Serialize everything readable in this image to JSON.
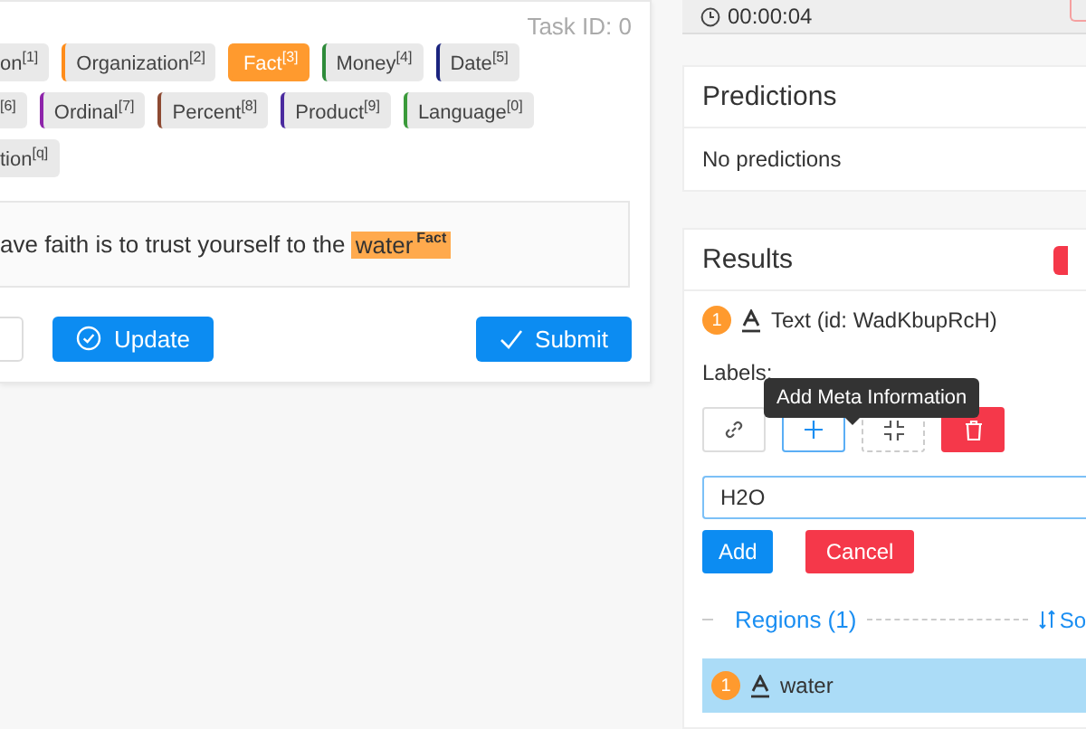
{
  "task": {
    "task_id": "Task ID: 0"
  },
  "label_rows": [
    [
      {
        "text": "on",
        "hotkey": "[1]",
        "selected": false
      },
      {
        "text": "Organization",
        "hotkey": "[2]",
        "color": "#ff8c1a",
        "selected": false
      },
      {
        "text": "Fact",
        "hotkey": "[3]",
        "color": "#ff9a2e",
        "selected": true
      },
      {
        "text": "Money",
        "hotkey": "[4]",
        "color": "#2e8b3a",
        "selected": false
      },
      {
        "text": "Date",
        "hotkey": "[5]",
        "color": "#1a237e",
        "selected": false
      }
    ],
    [
      {
        "text": "",
        "hotkey": "[6]",
        "selected": false
      },
      {
        "text": "Ordinal",
        "hotkey": "[7]",
        "color": "#8e24aa",
        "selected": false
      },
      {
        "text": "Percent",
        "hotkey": "[8]",
        "color": "#8d4a32",
        "selected": false
      },
      {
        "text": "Product",
        "hotkey": "[9]",
        "color": "#4a2a9e",
        "selected": false
      },
      {
        "text": "Language",
        "hotkey": "[0]",
        "color": "#3a9a3a",
        "selected": false
      }
    ],
    [
      {
        "text": "tion",
        "hotkey": "[q]",
        "selected": false
      }
    ]
  ],
  "sentence": {
    "before": "ave faith is to trust yourself to the ",
    "highlight": "water",
    "highlight_label": "Fact"
  },
  "buttons": {
    "update": "Update",
    "submit": "Submit"
  },
  "timer": "00:00:04",
  "predictions": {
    "title": "Predictions",
    "empty": "No predictions"
  },
  "results": {
    "title": "Results",
    "entity_number": "1",
    "entity": "Text (id: WadKbupRcH)",
    "labels_caption": "Labels:",
    "tooltip": "Add Meta Information",
    "meta_input": "H2O",
    "add": "Add",
    "cancel": "Cancel",
    "regions_title": "Regions (1)",
    "sort": "So",
    "regions": [
      {
        "number": "1",
        "text": "water",
        "selected": true
      }
    ]
  }
}
